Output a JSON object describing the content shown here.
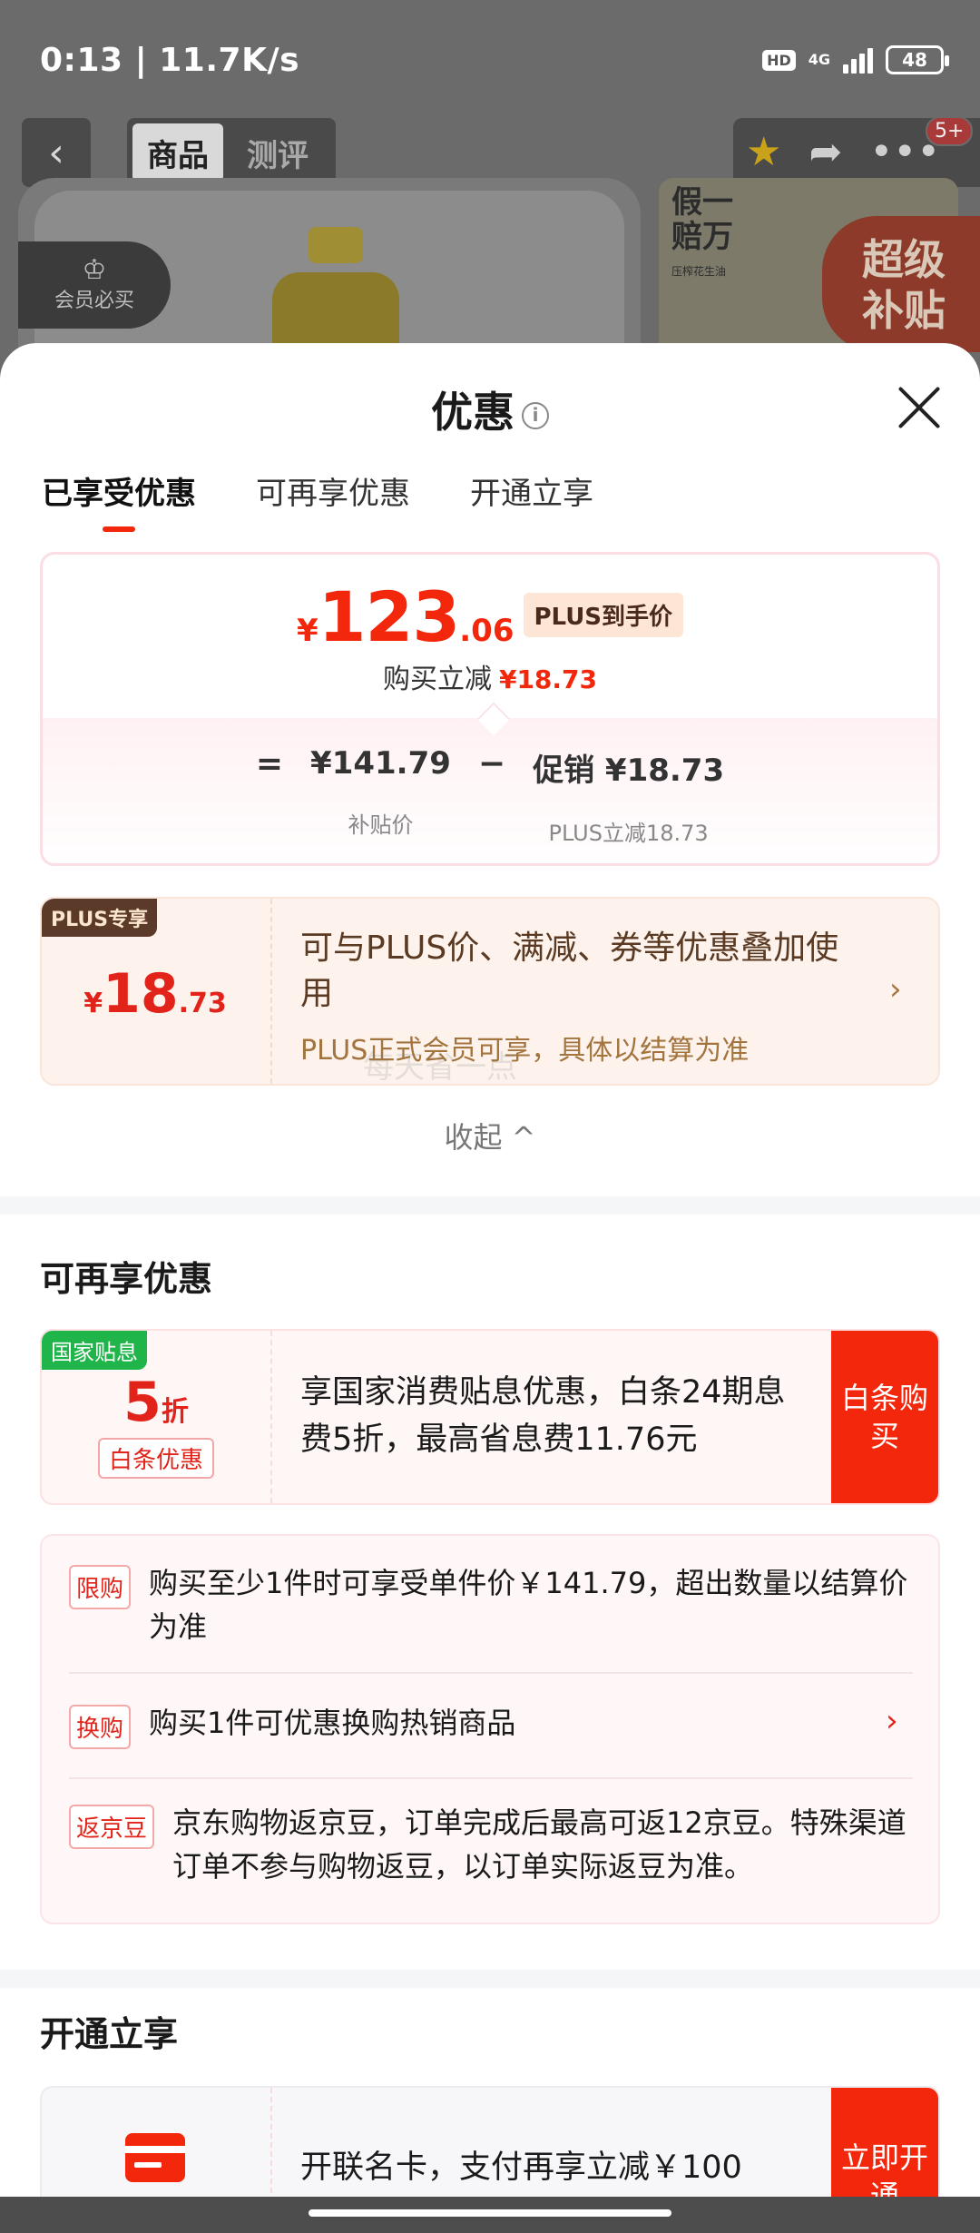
{
  "status_bar": {
    "time_speed": "0:13 | 11.7K/s",
    "hd": "HD",
    "network": "4G",
    "battery": "48"
  },
  "product_nav": {
    "tabs": [
      "商品",
      "测评"
    ],
    "notification_count": "5+"
  },
  "product_preview": {
    "member_badge": "会员必买",
    "side_badge_line1": "假一",
    "side_badge_line2": "赔万",
    "side_badge_small": "压榨花生油",
    "super_subsidy": "超级补贴"
  },
  "sheet": {
    "title": "优惠",
    "tabs": [
      "已享受优惠",
      "可再享优惠",
      "开通立享"
    ],
    "price": {
      "yen": "¥",
      "integer": "123",
      "decimal": ".06",
      "tag": "PLUS到手价",
      "reduce_label": "购买立减",
      "reduce_value": "¥18.73",
      "equals": "=",
      "subsidy_value": "¥141.79",
      "subsidy_label": "补贴价",
      "minus": "−",
      "promo_value": "促销 ¥18.73",
      "promo_label": "PLUS立减18.73"
    },
    "plus_card": {
      "flag": "PLUS专享",
      "yen": "¥",
      "integer": "18",
      "decimal": ".73",
      "text": "可与PLUS价、满减、券等优惠叠加使用",
      "note": "PLUS正式会员可享，具体以结算为准"
    },
    "watermark": "每天省一点",
    "collapse_label": "收起 ^"
  },
  "available": {
    "section_title": "可再享优惠",
    "baitiao": {
      "flag": "国家贴息",
      "discount_num": "5",
      "discount_unit": "折",
      "tag": "白条优惠",
      "desc": "享国家消费贴息优惠，白条24期息费5折，最高省息费11.76元",
      "action": "白条购买"
    },
    "promos": [
      {
        "tag": "限购",
        "text": "购买至少1件时可享受单件价￥141.79，超出数量以结算价为准"
      },
      {
        "tag": "换购",
        "text": "购买1件可优惠换购热销商品"
      },
      {
        "tag": "返京豆",
        "text": "京东购物返京豆，订单完成后最高可返12京豆。特殊渠道订单不参与购物返豆，以订单实际返豆为准。"
      }
    ]
  },
  "open": {
    "section_title": "开通立享",
    "card_text": "开联名卡，支付再享立减￥100",
    "action": "立即开通"
  },
  "colors": {
    "brand_red": "#f2270c",
    "plus_brown": "#5a3a22",
    "green_flag": "#20b54a"
  }
}
